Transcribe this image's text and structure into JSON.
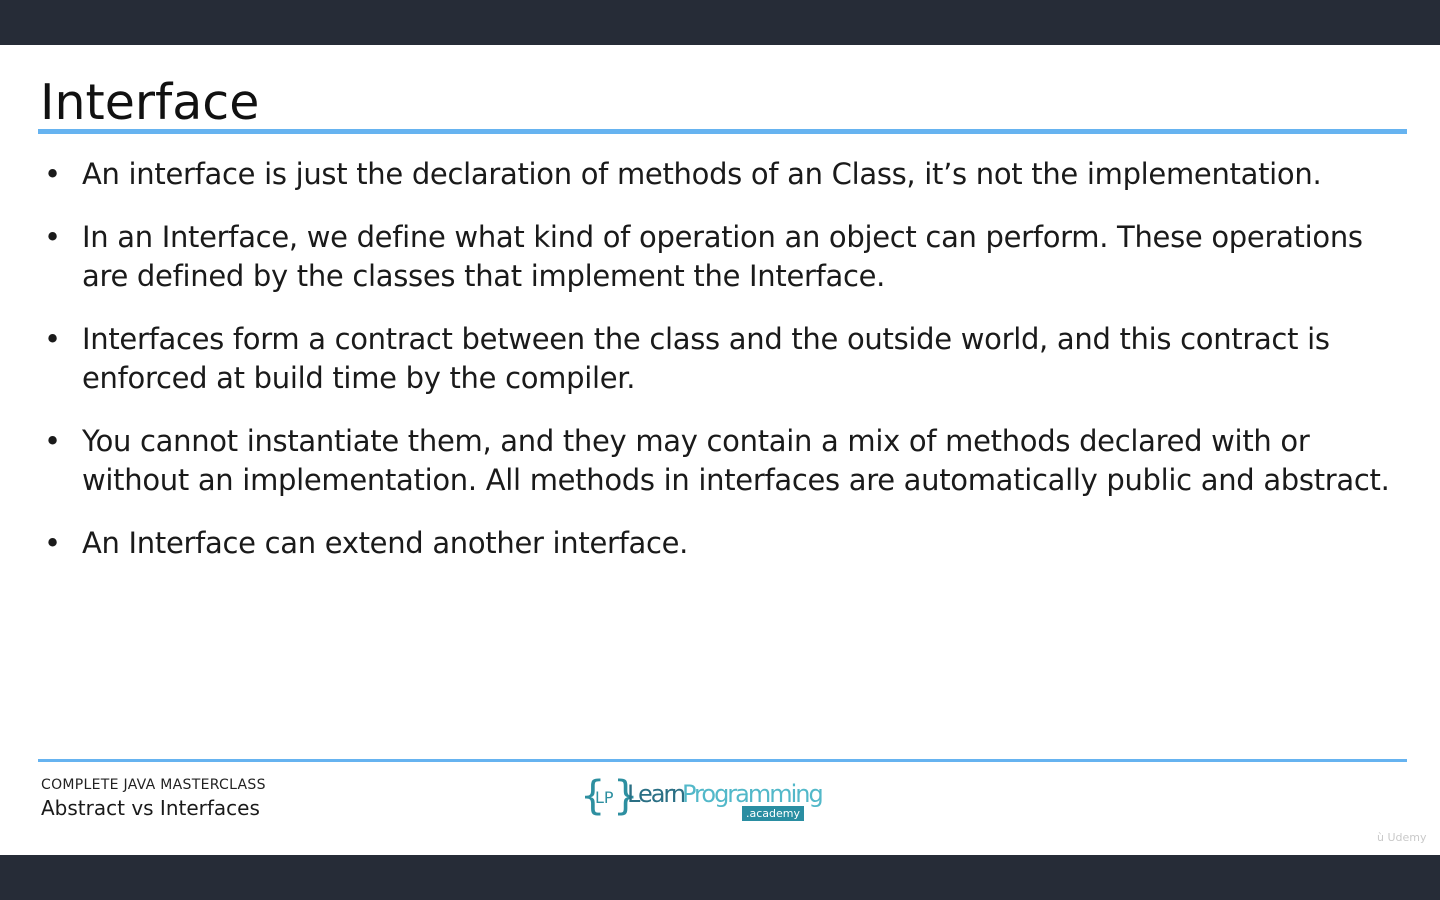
{
  "slide": {
    "title": "Interface",
    "bullets": [
      "An interface is just the declaration of methods of an Class, it’s not the implementation.",
      "In an Interface, we define what kind of operation an object can perform. These operations are defined by the classes that implement the Interface.",
      "Interfaces form a contract between the class and the outside world, and this contract is enforced at build time by the compiler.",
      "You cannot instantiate them, and they may contain a mix of methods declared with or without an implementation. All methods in interfaces are automatically public and abstract.",
      "An Interface can extend another interface."
    ],
    "bullet_glyph": "•"
  },
  "footer": {
    "course": "COMPLETE JAVA MASTERCLASS",
    "section": "Abstract vs Interfaces"
  },
  "logo": {
    "brace_open": "{",
    "initials": "LP",
    "brace_close": "}",
    "word_learn": "Learn",
    "word_programming": "Programming",
    "badge": ".academy"
  },
  "watermark": {
    "text": "Udemy"
  },
  "colors": {
    "accent_rule": "#66b3f0",
    "frame": "#262c37",
    "logo_dark": "#2a6f84",
    "logo_light": "#52b8c9"
  }
}
